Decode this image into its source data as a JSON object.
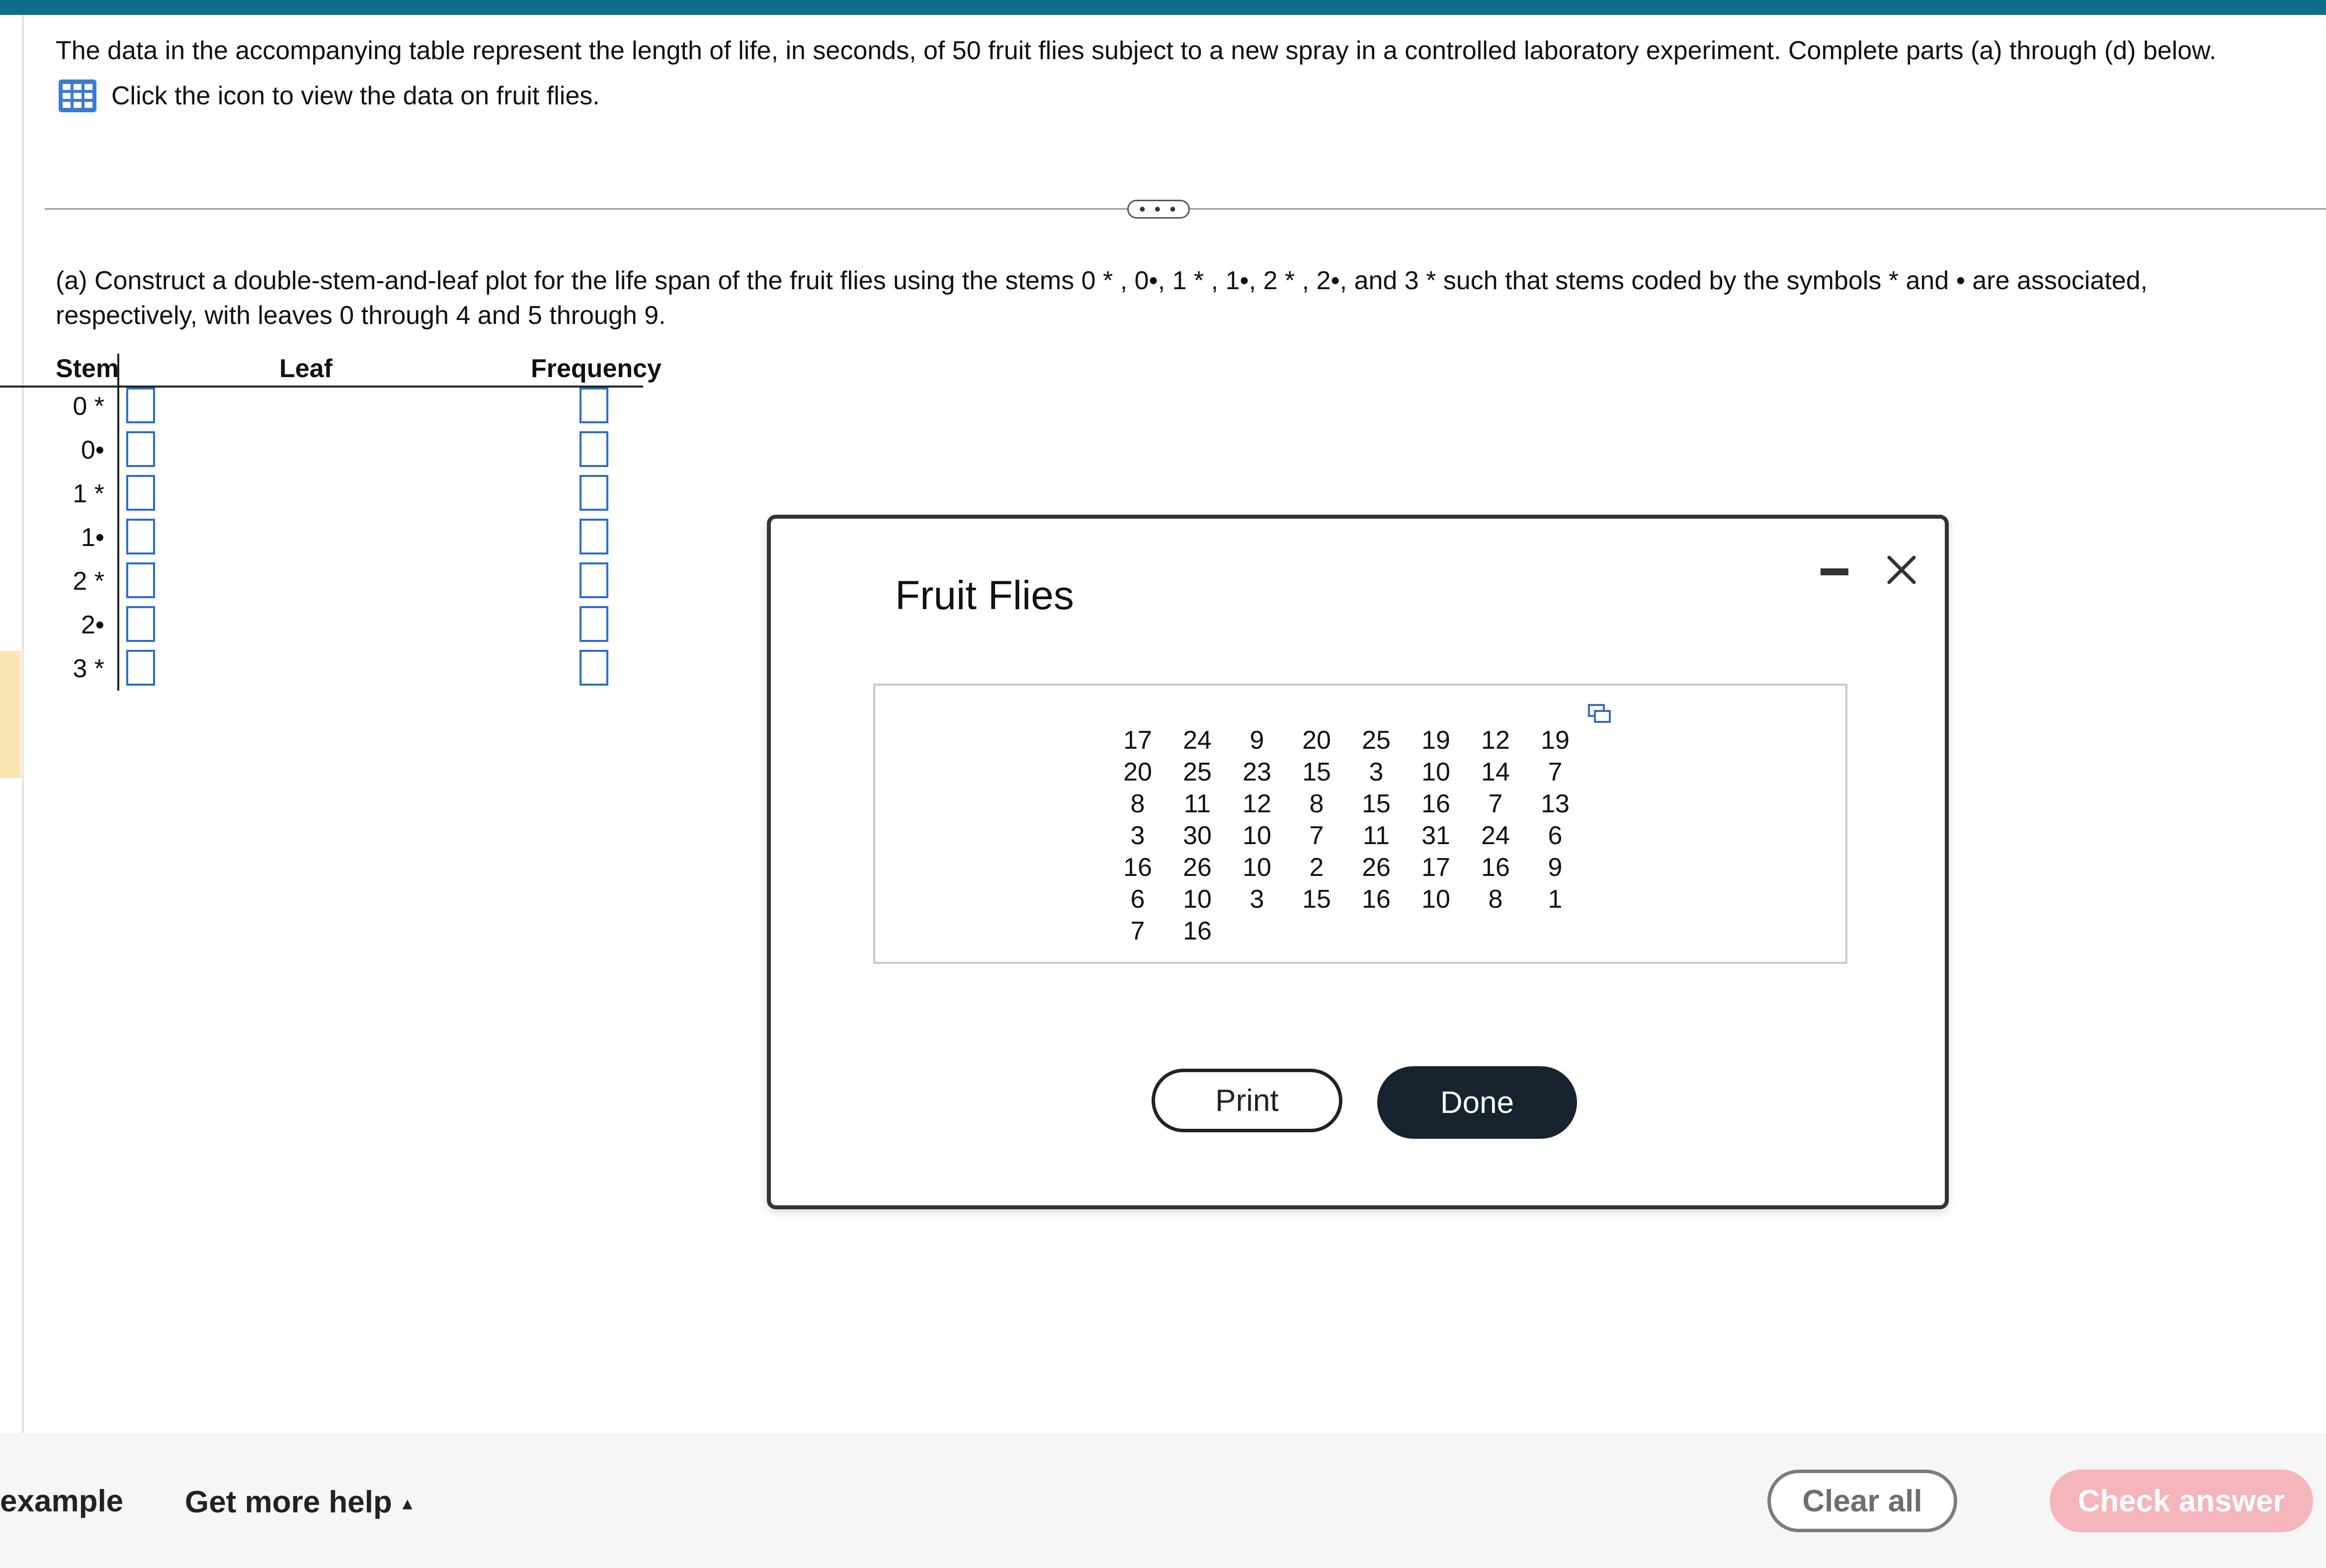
{
  "question": {
    "intro": "The data in the accompanying table represent the length of life, in seconds, of 50 fruit flies subject to a new spray in a controlled laboratory experiment. Complete parts (a) through (d) below.",
    "data_link": "Click the icon to view the data on fruit flies.",
    "more_label": "• • •",
    "part_a": "(a) Construct a double-stem-and-leaf plot for the life span of the fruit flies using the stems 0 * , 0•, 1 * , 1•, 2 * , 2•, and 3 *  such that stems coded by the symbols  *  and • are associated, respectively, with leaves 0 through 4 and 5 through 9."
  },
  "stem_leaf": {
    "headers": {
      "stem": "Stem",
      "leaf": "Leaf",
      "frequency": "Frequency"
    },
    "stems": [
      "0 *",
      "0•",
      "1 *",
      "1•",
      "2 *",
      "2•",
      "3 *"
    ]
  },
  "dialog": {
    "title": "Fruit Flies",
    "rows": [
      [
        "17",
        "24",
        "9",
        "20",
        "25",
        "19",
        "12",
        "19"
      ],
      [
        "20",
        "25",
        "23",
        "15",
        "3",
        "10",
        "14",
        "7"
      ],
      [
        "8",
        "11",
        "12",
        "8",
        "15",
        "16",
        "7",
        "13"
      ],
      [
        "3",
        "30",
        "10",
        "7",
        "11",
        "31",
        "24",
        "6"
      ],
      [
        "16",
        "26",
        "10",
        "2",
        "26",
        "17",
        "16",
        "9"
      ],
      [
        "6",
        "10",
        "3",
        "15",
        "16",
        "10",
        "8",
        "1"
      ],
      [
        "7",
        "16"
      ]
    ],
    "print_label": "Print",
    "done_label": "Done"
  },
  "footer": {
    "example_label": "example",
    "help_label": "Get more help",
    "help_caret": "▲",
    "clear_label": "Clear all",
    "check_label": "Check answer"
  },
  "colors": {
    "accent_bar": "#0f6d8c",
    "input_border": "#2b6bd1",
    "done_button": "#182330",
    "check_button": "#f4b5bb"
  }
}
